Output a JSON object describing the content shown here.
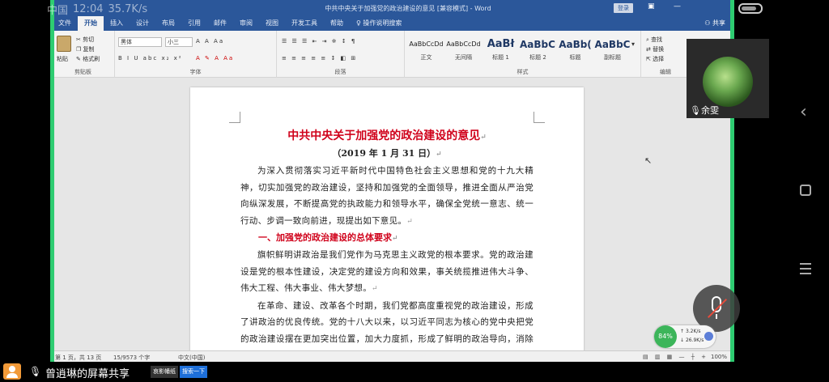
{
  "phone_status": {
    "signal": "中国",
    "time": "12:04",
    "speed": "35.7K/s"
  },
  "word": {
    "window_title": "中共中央关于加强党的政治建设的意见 [兼容模式] - Word",
    "login_label": "登录",
    "tabs": [
      "文件",
      "开始",
      "插入",
      "设计",
      "布局",
      "引用",
      "邮件",
      "审阅",
      "视图",
      "开发工具",
      "帮助"
    ],
    "tell_me": "操作说明搜索",
    "share_label": "共享",
    "clipboard": {
      "paste": "粘贴",
      "cut": "剪切",
      "copy": "复制",
      "format_painter": "格式刷",
      "group_label": "剪贴板"
    },
    "font": {
      "name": "黑体",
      "size": "小三",
      "group_label": "字体"
    },
    "paragraph": {
      "group_label": "段落"
    },
    "styles": {
      "group_label": "样式",
      "items": [
        {
          "sample": "AaBbCcDd",
          "name": "正文"
        },
        {
          "sample": "AaBbCcDd",
          "name": "无间隔"
        },
        {
          "sample": "AaBł",
          "name": "标题 1"
        },
        {
          "sample": "AaBbC(",
          "name": "标题 2"
        },
        {
          "sample": "AaBb(",
          "name": "标题"
        },
        {
          "sample": "AaBbC",
          "name": "副标题"
        }
      ]
    },
    "editing": {
      "find": "查找",
      "replace": "替换",
      "select": "选择",
      "group_label": "编辑"
    },
    "document": {
      "title": "中共中央关于加强党的政治建设的意见",
      "date": "（2019 年 1 月 31 日）",
      "para1": "为深入贯彻落实习近平新时代中国特色社会主义思想和党的十九大精神，切实加强党的政治建设，坚持和加强党的全面领导，推进全面从严治党向纵深发展，不断提高党的执政能力和领导水平，确保全党统一意志、统一行动、步调一致向前进，现提出如下意见。",
      "heading1": "一、加强党的政治建设的总体要求",
      "para2": "旗帜鲜明讲政治是我们党作为马克思主义政党的根本要求。党的政治建设是党的根本性建设，决定党的建设方向和效果，事关统揽推进伟大斗争、伟大工程、伟大事业、伟大梦想。",
      "para3": "在革命、建设、改革各个时期，我们党都高度重视党的政治建设，形成了讲政治的优良传统。党的十八大以来，以习近平同志为核心的党中央把党的政治建设摆在更加突出位置，加大力度抓，形成了鲜明的政治导向，消除了党内严重政治隐患，推动党的政治建"
    },
    "statusbar": {
      "page": "第 1 页，共 13 页",
      "words": "15/9573 个字",
      "lang": "中文(中国)",
      "zoom": "100%"
    }
  },
  "meeting": {
    "participant_name": "余雯",
    "screen_share_label": "曾逍琳的屏幕共享",
    "net_percent": "84%",
    "net_up": "3.2K/s",
    "net_down": "26.9K/s",
    "taskbar_items": [
      "哀影幡纸",
      "搜索一下"
    ]
  }
}
